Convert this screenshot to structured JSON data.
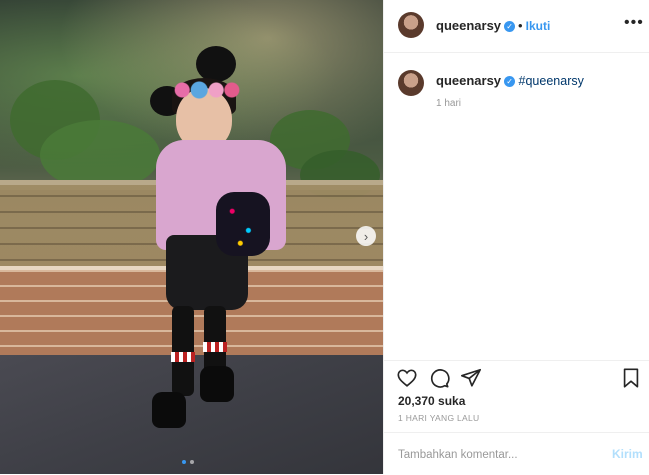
{
  "post": {
    "username": "queenarsy",
    "follow_label": "Ikuti",
    "more_glyph": "•••",
    "verified_glyph": "✓",
    "caption_hashtag": "#queenarsy",
    "caption_time": "1 hari",
    "likes": "20,370 suka",
    "timestamp": "1 HARI YANG LALU",
    "comment_placeholder": "Tambahkan komentar...",
    "post_label": "Kirim",
    "next_glyph": "›"
  },
  "carousel": {
    "total": 2,
    "current": 1
  },
  "icons": [
    "heart-icon",
    "comment-icon",
    "share-icon",
    "bookmark-icon",
    "verified-badge-icon",
    "chevron-right-icon",
    "more-icon"
  ],
  "colors": {
    "accent": "#3897f0",
    "text": "#262626",
    "muted": "#999999",
    "border": "#efefef",
    "post_disabled": "#b2dffc"
  }
}
